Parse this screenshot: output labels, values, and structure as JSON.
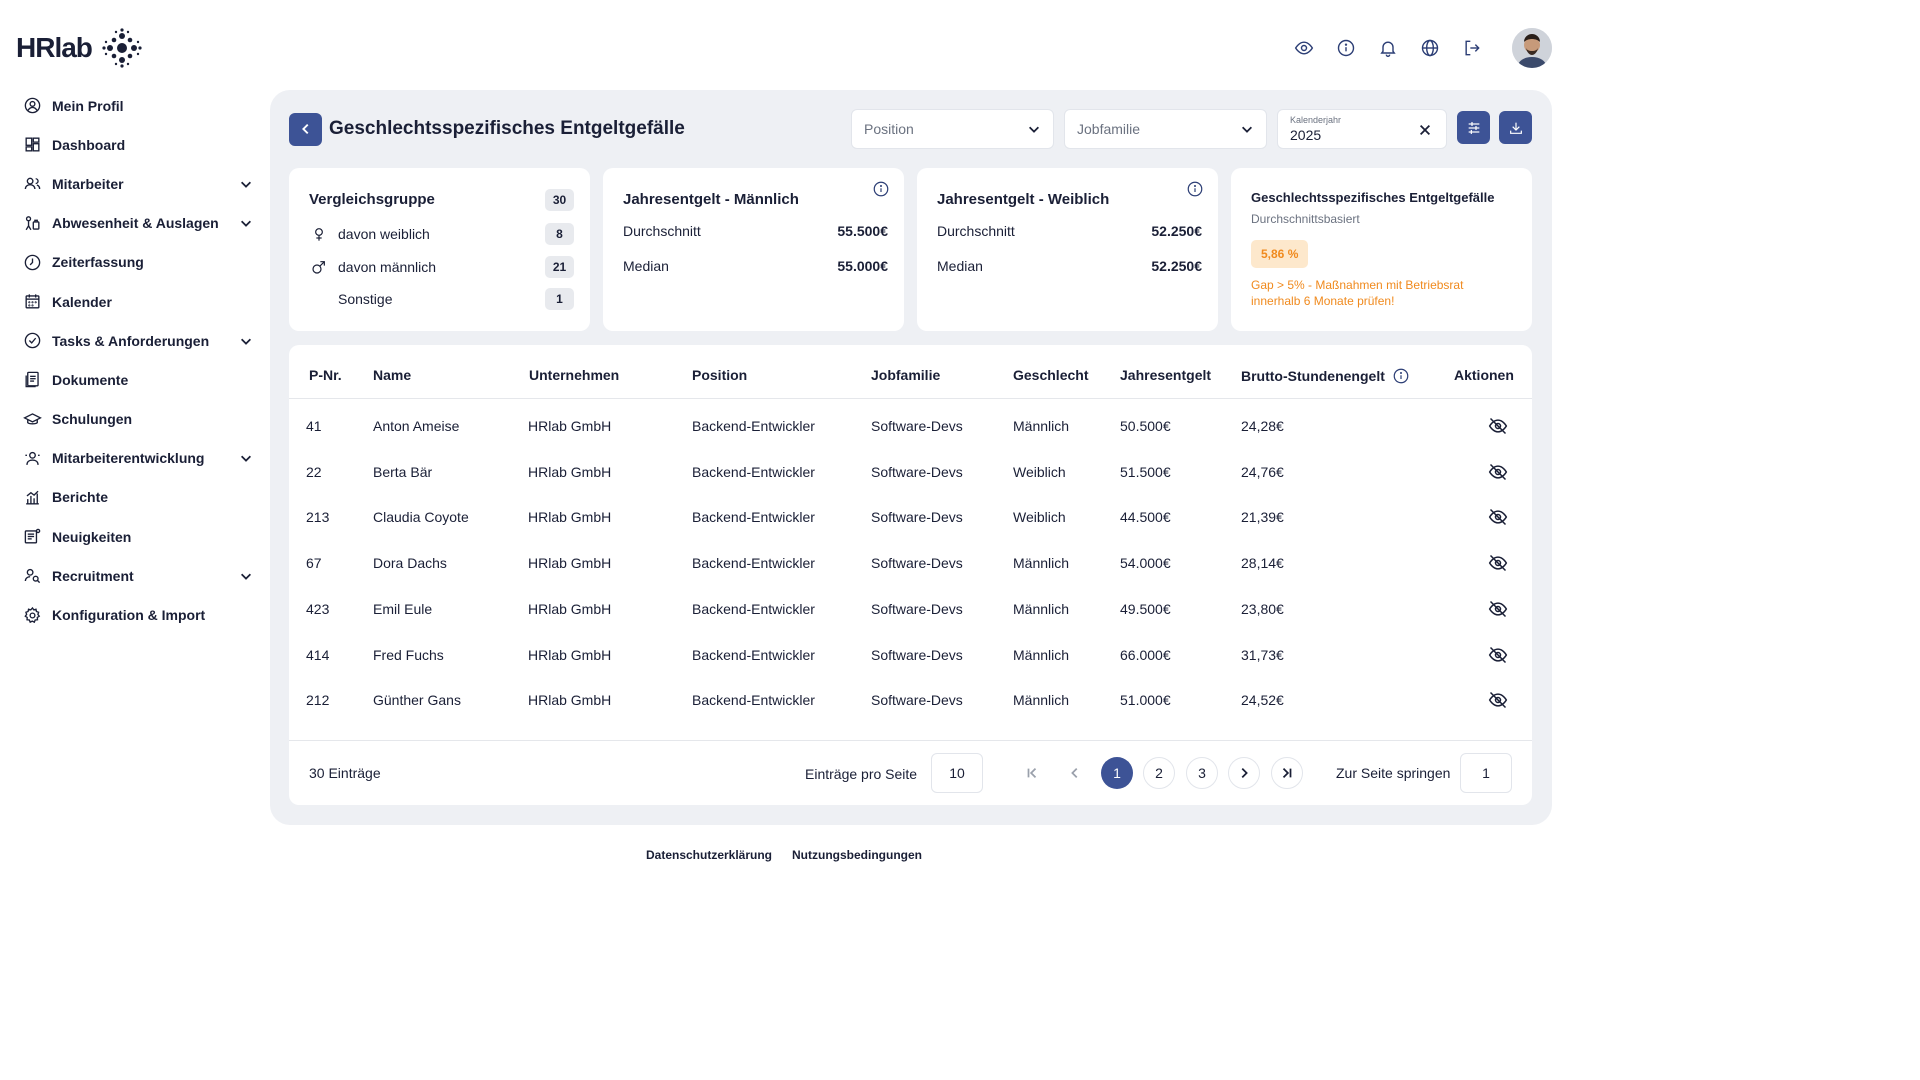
{
  "brand": {
    "logo_text": "HRlab",
    "accent": "#3d5396",
    "warning": "#f08a1e"
  },
  "topbar": {
    "icons": [
      "eye-icon",
      "info-icon",
      "bell-icon",
      "globe-icon",
      "logout-icon"
    ]
  },
  "sidebar": {
    "items": [
      {
        "label": "Mein Profil",
        "icon": "user-circle-icon",
        "expandable": false
      },
      {
        "label": "Dashboard",
        "icon": "dashboard-icon",
        "expandable": false
      },
      {
        "label": "Mitarbeiter",
        "icon": "users-icon",
        "expandable": true
      },
      {
        "label": "Abwesenheit & Auslagen",
        "icon": "absence-icon",
        "expandable": true
      },
      {
        "label": "Zeiterfassung",
        "icon": "clock-icon",
        "expandable": false
      },
      {
        "label": "Kalender",
        "icon": "calendar-icon",
        "expandable": false
      },
      {
        "label": "Tasks & Anforderungen",
        "icon": "check-circle-icon",
        "expandable": true
      },
      {
        "label": "Dokumente",
        "icon": "document-icon",
        "expandable": false
      },
      {
        "label": "Schulungen",
        "icon": "graduation-cap-icon",
        "expandable": false
      },
      {
        "label": "Mitarbeiterentwicklung",
        "icon": "development-icon",
        "expandable": true
      },
      {
        "label": "Berichte",
        "icon": "chart-icon",
        "expandable": false
      },
      {
        "label": "Neuigkeiten",
        "icon": "news-icon",
        "expandable": false
      },
      {
        "label": "Recruitment",
        "icon": "recruitment-icon",
        "expandable": true
      },
      {
        "label": "Konfiguration & Import",
        "icon": "settings-icon",
        "expandable": false
      }
    ]
  },
  "header": {
    "title": "Geschlechtsspezifisches Entgeltgefälle",
    "position_placeholder": "Position",
    "jobfamilie_placeholder": "Jobfamilie",
    "year_label": "Kalenderjahr",
    "year_value": "2025"
  },
  "cards": {
    "vergleich": {
      "title": "Vergleichsgruppe",
      "total": "30",
      "rows": [
        {
          "label": "davon weiblich",
          "count": "8"
        },
        {
          "label": "davon männlich",
          "count": "21"
        },
        {
          "label": "Sonstige",
          "count": "1"
        }
      ]
    },
    "maennlich": {
      "title": "Jahresentgelt - Männlich",
      "avg_label": "Durchschnitt",
      "avg_value": "55.500€",
      "median_label": "Median",
      "median_value": "55.000€"
    },
    "weiblich": {
      "title": "Jahresentgelt - Weiblich",
      "avg_label": "Durchschnitt",
      "avg_value": "52.250€",
      "median_label": "Median",
      "median_value": "52.250€"
    },
    "gap": {
      "title": "Geschlechtsspezifisches Entgeltgefälle",
      "subtitle": "Durchschnittsbasiert",
      "value": "5,86 %",
      "note": "Gap > 5% - Maßnahmen mit Betriebsrat innerhalb 6 Monate prüfen!"
    }
  },
  "table": {
    "columns": [
      "P-Nr.",
      "Name",
      "Unternehmen",
      "Position",
      "Jobfamilie",
      "Geschlecht",
      "Jahresentgelt",
      "Brutto-Stundenengelt",
      "Aktionen"
    ],
    "rows": [
      [
        "41",
        "Anton Ameise",
        "HRlab GmbH",
        "Backend-Entwickler",
        "Software-Devs",
        "Männlich",
        "50.500€",
        "24,28€"
      ],
      [
        "22",
        "Berta Bär",
        "HRlab GmbH",
        "Backend-Entwickler",
        "Software-Devs",
        "Weiblich",
        "51.500€",
        "24,76€"
      ],
      [
        "213",
        "Claudia Coyote",
        "HRlab GmbH",
        "Backend-Entwickler",
        "Software-Devs",
        "Weiblich",
        "44.500€",
        "21,39€"
      ],
      [
        "67",
        "Dora Dachs",
        "HRlab GmbH",
        "Backend-Entwickler",
        "Software-Devs",
        "Männlich",
        "54.000€",
        "28,14€"
      ],
      [
        "423",
        "Emil Eule",
        "HRlab GmbH",
        "Backend-Entwickler",
        "Software-Devs",
        "Männlich",
        "49.500€",
        "23,80€"
      ],
      [
        "414",
        "Fred Fuchs",
        "HRlab GmbH",
        "Backend-Entwickler",
        "Software-Devs",
        "Männlich",
        "66.000€",
        "31,73€"
      ],
      [
        "212",
        "Günther Gans",
        "HRlab GmbH",
        "Backend-Entwickler",
        "Software-Devs",
        "Männlich",
        "51.000€",
        "24,52€"
      ]
    ],
    "footer": {
      "entries": "30 Einträge",
      "per_page_label": "Einträge pro Seite",
      "per_page_value": "10",
      "pages": [
        "1",
        "2",
        "3"
      ],
      "current_page": "1",
      "jump_label": "Zur Seite springen",
      "jump_value": "1"
    }
  },
  "footer": {
    "privacy": "Datenschutzerklärung",
    "terms": "Nutzungsbedingungen"
  }
}
